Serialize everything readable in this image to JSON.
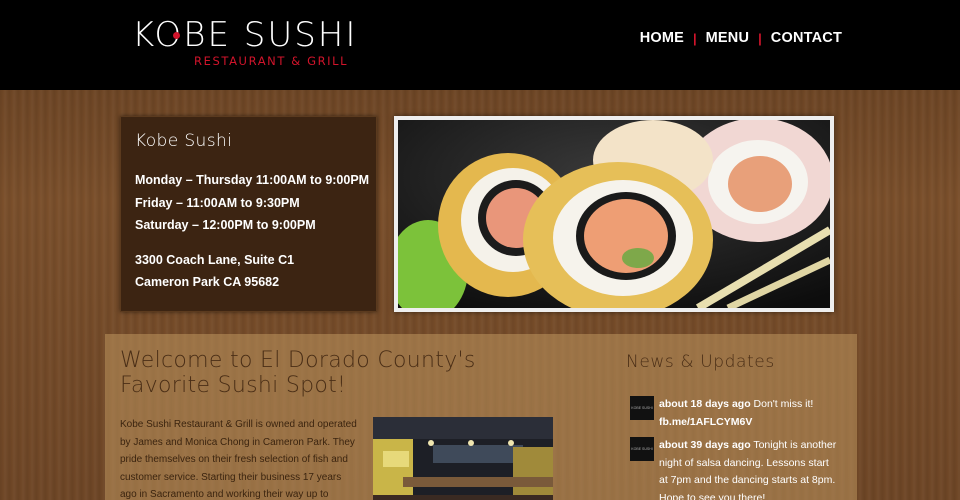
{
  "logo": {
    "title": "KOBE SUSHI",
    "subtitle": "RESTAURANT & GRILL"
  },
  "nav": {
    "items": [
      "HOME",
      "MENU",
      "CONTACT"
    ],
    "separator": "|"
  },
  "hours": {
    "title": "Kobe Sushi",
    "lines": [
      "Monday – Thursday 11:00AM to 9:00PM",
      "Friday – 11:00AM to 9:30PM",
      "Saturday – 12:00PM to 9:00PM"
    ],
    "address": [
      "3300 Coach Lane, Suite C1",
      "Cameron Park CA 95682"
    ]
  },
  "welcome": {
    "title_line1": "Welcome to El Dorado County's",
    "title_line2": "Favorite Sushi Spot!",
    "body": "Kobe Sushi Restaurant & Grill is owned and operated by James and Monica Chong in Cameron Park. They pride themselves on their fresh selection of fish and customer service. Starting their business 17 years ago in Sacramento and working their way up to Cameron"
  },
  "news": {
    "title": "News & Updates",
    "thumb_label": "KOBE SUSHI",
    "items": [
      {
        "when": "about 18 days ago",
        "text": "Don't miss it!",
        "link": "fb.me/1AFLCYM6V"
      },
      {
        "when": "about 39 days ago",
        "text": "Tonight is another night of salsa dancing. Lessons start at 7pm and the dancing starts at 8pm. Hope to see you there!"
      }
    ]
  },
  "colors": {
    "accent": "#d1142b",
    "header_bg": "#000000",
    "hours_bg": "#3c2412"
  },
  "icons": {
    "hero_image": "sushi-rolls-photo",
    "interior_image": "restaurant-interior-photo"
  }
}
